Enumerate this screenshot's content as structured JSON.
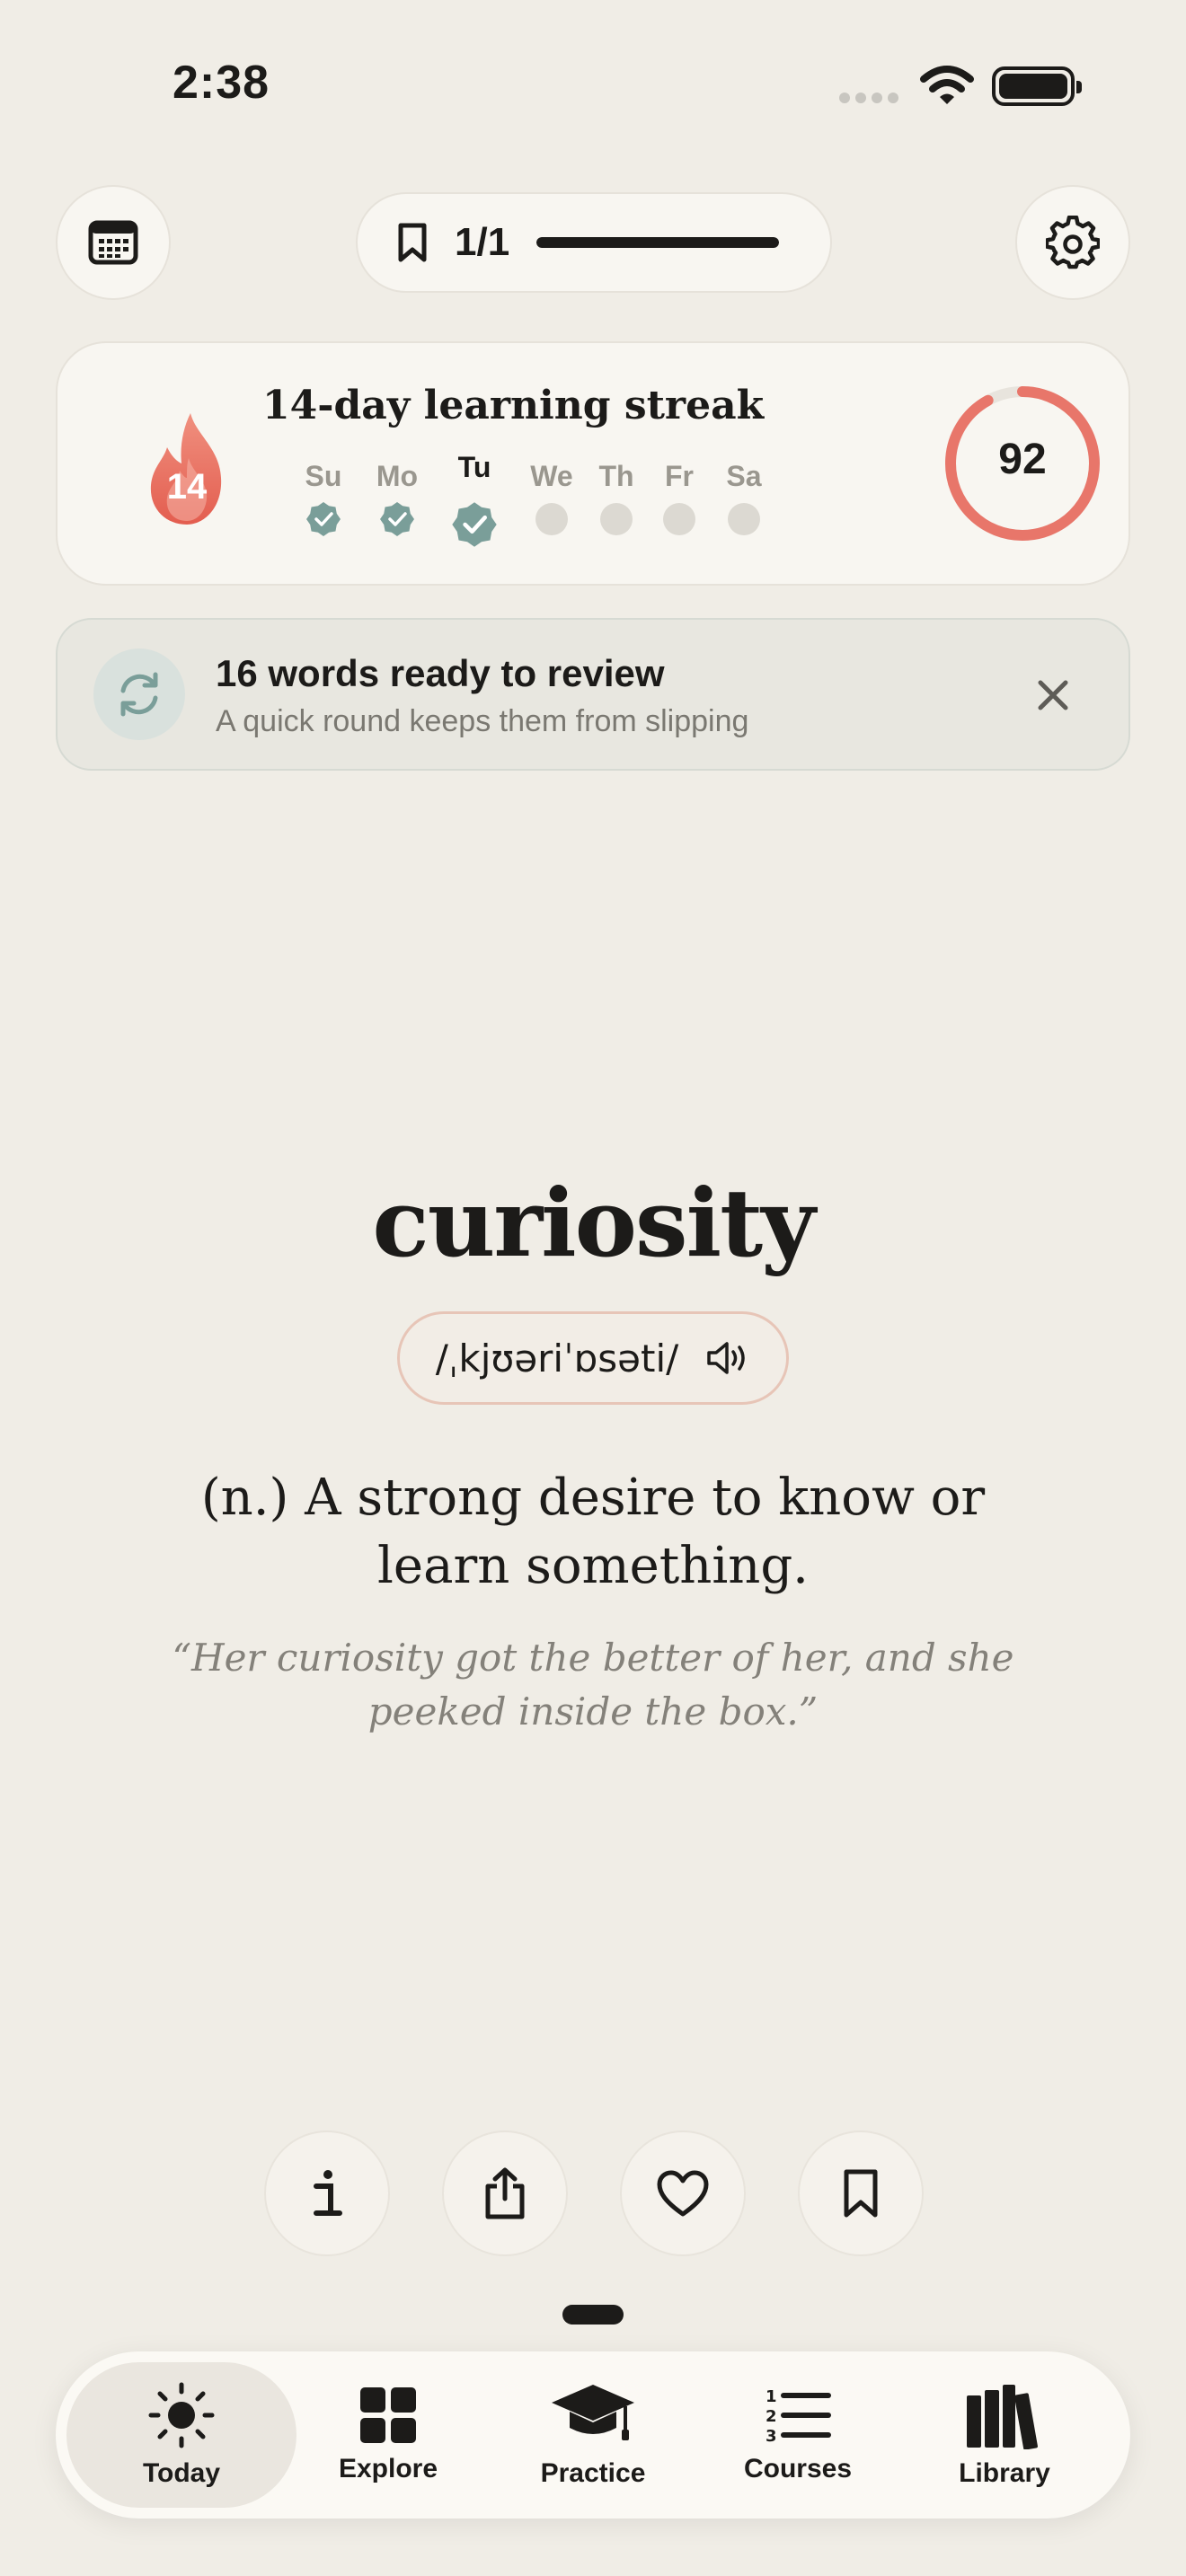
{
  "status_bar": {
    "time": "2:38"
  },
  "header": {
    "progress_label": "1/1",
    "progress_fraction": 1.0
  },
  "streak": {
    "title": "14-day learning streak",
    "count": "14",
    "days": [
      {
        "label": "Su",
        "done": true,
        "today": false
      },
      {
        "label": "Mo",
        "done": true,
        "today": false
      },
      {
        "label": "Tu",
        "done": true,
        "today": true
      },
      {
        "label": "We",
        "done": false,
        "today": false
      },
      {
        "label": "Th",
        "done": false,
        "today": false
      },
      {
        "label": "Fr",
        "done": false,
        "today": false
      },
      {
        "label": "Sa",
        "done": false,
        "today": false
      }
    ],
    "score": "92",
    "score_fraction": 0.92
  },
  "review": {
    "title": "16 words ready to review",
    "subtitle": "A quick round keeps them from slipping"
  },
  "word": {
    "text": "curiosity",
    "pronunciation": "/ˌkjʊəriˈɒsəti/",
    "definition": "(n.) A strong desire to know or learn something.",
    "example": "“Her curiosity got the better of her, and she peeked inside the box.”"
  },
  "tabs": [
    {
      "label": "Today",
      "icon": "sun-icon",
      "active": true
    },
    {
      "label": "Explore",
      "icon": "grid-icon",
      "active": false
    },
    {
      "label": "Practice",
      "icon": "graduation-cap-icon",
      "active": false
    },
    {
      "label": "Courses",
      "icon": "numbered-list-icon",
      "active": false
    },
    {
      "label": "Library",
      "icon": "books-icon",
      "active": false
    }
  ],
  "colors": {
    "background": "#f0ede6",
    "accent_coral": "#e8766a",
    "streak_check": "#7a9e99",
    "inactive_dot": "#dcd9d2"
  }
}
